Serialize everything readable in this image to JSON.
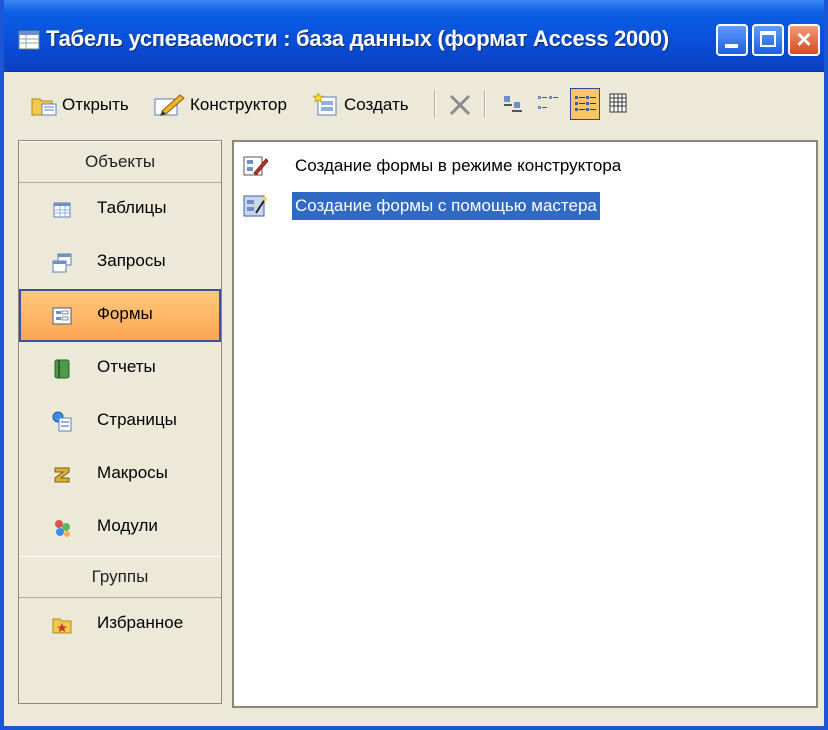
{
  "window": {
    "title": "Табель успеваемости : база данных (формат Access 2000)"
  },
  "toolbar": {
    "open_label": "Открыть",
    "design_label": "Конструктор",
    "create_label": "Создать"
  },
  "sidebar": {
    "objects_header": "Объекты",
    "groups_header": "Группы",
    "items": [
      {
        "label": "Таблицы",
        "icon": "table-icon"
      },
      {
        "label": "Запросы",
        "icon": "query-icon"
      },
      {
        "label": "Формы",
        "icon": "form-icon",
        "selected": true
      },
      {
        "label": "Отчеты",
        "icon": "report-icon"
      },
      {
        "label": "Страницы",
        "icon": "page-icon"
      },
      {
        "label": "Макросы",
        "icon": "macro-icon"
      },
      {
        "label": "Модули",
        "icon": "module-icon"
      }
    ],
    "groups": [
      {
        "label": "Избранное",
        "icon": "favorites-icon"
      }
    ]
  },
  "content": {
    "items": [
      {
        "label": "Создание формы в режиме конструктора",
        "icon": "design-form-icon"
      },
      {
        "label": "Создание формы с помощью мастера",
        "icon": "wizard-form-icon",
        "selected": true
      }
    ]
  },
  "colors": {
    "titlebar": "#0a4ed8",
    "selected_nav": "#fca653",
    "selection": "#316ac5"
  }
}
